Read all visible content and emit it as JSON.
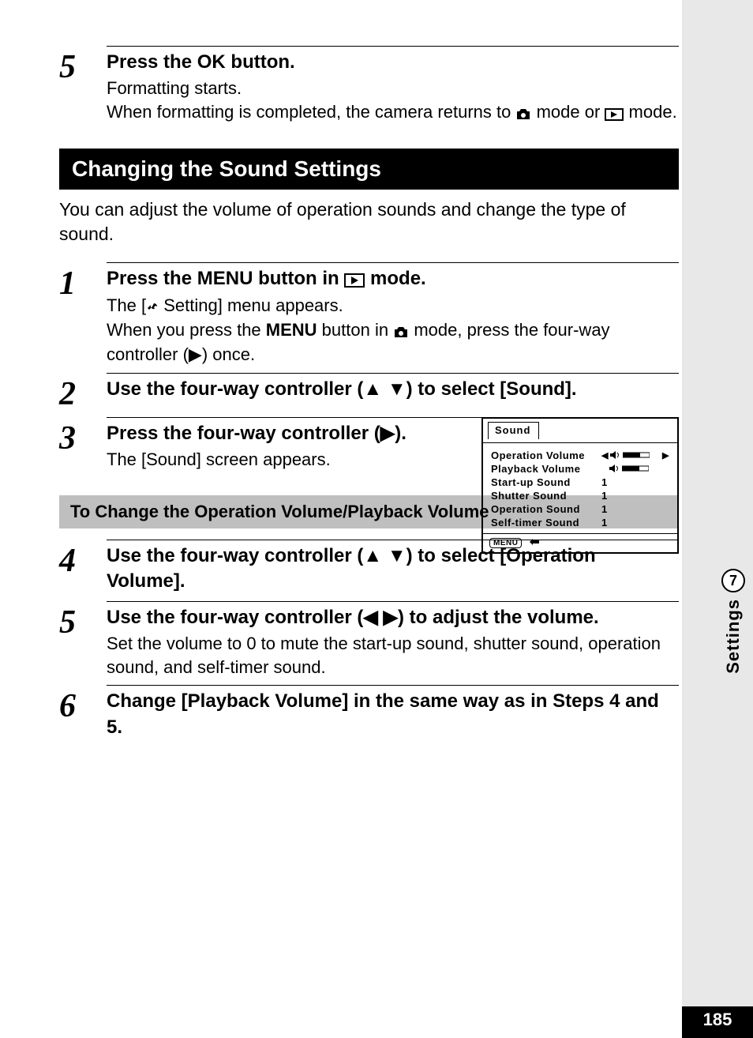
{
  "sidebar": {
    "chapter_num": "7",
    "chapter_label": "Settings",
    "page_num": "185"
  },
  "step5a": {
    "num": "5",
    "head_pre": "Press the ",
    "head_ok": "OK",
    "head_post": " button.",
    "line1": "Formatting starts.",
    "line2a": "When formatting is completed, the camera returns to ",
    "line2b": " mode or ",
    "line2c": " mode."
  },
  "section_heading": "Changing the Sound Settings",
  "intro": "You can adjust the volume of operation sounds and change the type of sound.",
  "step1": {
    "num": "1",
    "head_pre": "Press the ",
    "head_menu": "MENU",
    "head_mid": " button in ",
    "head_post": " mode.",
    "line1a": "The [",
    "line1b": " Setting] menu appears.",
    "line2a": "When you press the ",
    "line2b": "MENU",
    "line2c": " button in ",
    "line2d": " mode, press the four-way controller (",
    "line2e": ") once."
  },
  "step2": {
    "num": "2",
    "head_pre": "Use the four-way controller (",
    "head_post": ") to select [Sound]."
  },
  "step3": {
    "num": "3",
    "head_pre": "Press the four-way controller (",
    "head_post": ").",
    "line1": "The [Sound] screen appears."
  },
  "sound_panel": {
    "tab": "Sound",
    "rows": [
      {
        "label": "Operation Volume",
        "type": "slider"
      },
      {
        "label": "Playback Volume",
        "type": "slider_noarrow"
      },
      {
        "label": "Start-up Sound",
        "value": "1"
      },
      {
        "label": "Shutter Sound",
        "value": "1"
      },
      {
        "label": "Operation Sound",
        "value": "1"
      },
      {
        "label": "Self-timer Sound",
        "value": "1"
      }
    ],
    "menu_label": "MENU"
  },
  "subheading": "To Change the Operation Volume/Playback Volume",
  "step4": {
    "num": "4",
    "head_pre": "Use the four-way controller (",
    "head_post": ") to select [Operation Volume]."
  },
  "step5b": {
    "num": "5",
    "head_pre": "Use the four-way controller (",
    "head_post": ") to adjust the volume.",
    "line1": "Set the volume to 0 to mute the start-up sound, shutter sound, operation sound, and self-timer sound."
  },
  "step6": {
    "num": "6",
    "head": "Change [Playback Volume] in the same way as in Steps 4 and 5."
  }
}
